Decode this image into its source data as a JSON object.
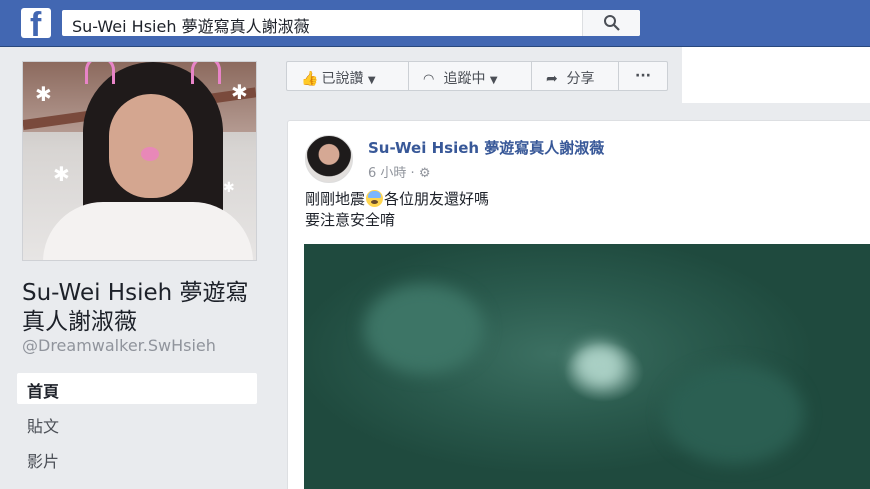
{
  "topbar": {
    "logo": "f",
    "search_value": "Su-Wei Hsieh 夢遊寫真人謝淑薇",
    "search_icon": "search-icon"
  },
  "profile": {
    "name": "Su-Wei Hsieh 夢遊寫真人謝淑薇",
    "handle": "@Dreamwalker.SwHsieh"
  },
  "nav": {
    "items": [
      {
        "label": "首頁",
        "active": true
      },
      {
        "label": "貼文",
        "active": false
      },
      {
        "label": "影片",
        "active": false
      }
    ]
  },
  "actions": {
    "liked": "已說讚",
    "following": "追蹤中",
    "share": "分享",
    "more": "···"
  },
  "post": {
    "author": "Su-Wei Hsieh 夢遊寫真人謝淑薇",
    "time": "6 小時 · ",
    "text_line1_a": "剛剛地震",
    "text_line1_b": "各位朋友還好嗎",
    "text_line2": "要注意安全唷"
  },
  "colors": {
    "brand": "#4267b2",
    "link": "#385898",
    "background": "#e9ebee"
  }
}
